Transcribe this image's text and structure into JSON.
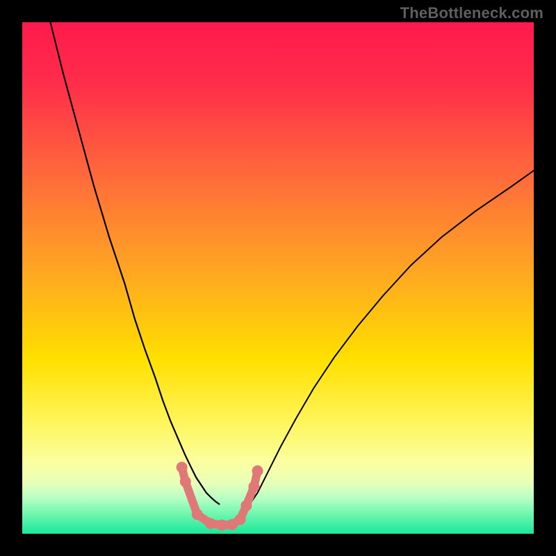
{
  "watermark": "TheBottleneck.com",
  "chart_data": {
    "type": "line",
    "title": "",
    "xlabel": "",
    "ylabel": "",
    "xlim": [
      0,
      100
    ],
    "ylim": [
      0,
      100
    ],
    "grid": false,
    "legend": null,
    "background_gradient_stops": [
      {
        "offset": 0.0,
        "color": "#ff1a4d"
      },
      {
        "offset": 0.12,
        "color": "#ff2d4a"
      },
      {
        "offset": 0.3,
        "color": "#ff6a3b"
      },
      {
        "offset": 0.48,
        "color": "#ffa423"
      },
      {
        "offset": 0.66,
        "color": "#ffe000"
      },
      {
        "offset": 0.78,
        "color": "#fff55a"
      },
      {
        "offset": 0.86,
        "color": "#fbffa0"
      },
      {
        "offset": 0.9,
        "color": "#e8ffb8"
      },
      {
        "offset": 0.93,
        "color": "#b8ffc4"
      },
      {
        "offset": 0.96,
        "color": "#72f7b0"
      },
      {
        "offset": 1.0,
        "color": "#18e89a"
      }
    ],
    "series": [
      {
        "name": "left-curve",
        "stroke": "#000000",
        "stroke_width": 2.2,
        "x": [
          5.5,
          8,
          11,
          14,
          17,
          20,
          22,
          24,
          26,
          27.5,
          29,
          30.5,
          31.8,
          33,
          34,
          35,
          36,
          37,
          37.8,
          38.5
        ],
        "y": [
          100,
          90,
          79,
          68,
          58,
          49,
          42,
          36,
          30.5,
          26,
          22,
          18.5,
          15.5,
          13,
          11,
          9.5,
          8,
          7,
          6.3,
          5.8
        ]
      },
      {
        "name": "right-curve",
        "stroke": "#000000",
        "stroke_width": 2.0,
        "x": [
          44.5,
          46,
          48,
          50.5,
          53.5,
          57,
          61,
          65.5,
          70.5,
          76,
          82,
          88.5,
          95.5,
          100
        ],
        "y": [
          5.8,
          8,
          12,
          17,
          22.5,
          28.5,
          34.5,
          40.5,
          46.5,
          52.5,
          58,
          63,
          67.8,
          71
        ]
      },
      {
        "name": "bottom-markers",
        "stroke": "#e07878",
        "stroke_width": 12,
        "marker_radius": 8,
        "x": [
          31.2,
          31.9,
          34.2,
          36.8,
          39.0,
          41.0,
          42.6,
          43.8,
          45.3,
          46.0
        ],
        "y": [
          13.0,
          10.2,
          3.8,
          2.0,
          1.7,
          1.8,
          2.8,
          5.5,
          9.2,
          12.3
        ]
      }
    ]
  }
}
